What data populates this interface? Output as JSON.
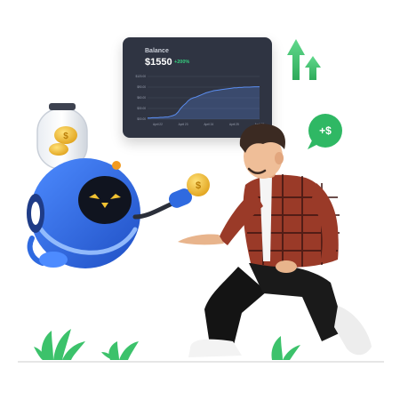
{
  "chart_data": {
    "type": "area",
    "title": "Balance",
    "balance": "$1550",
    "change": "+200%",
    "y_ticks": [
      "$120.00",
      "$90.00",
      "$60.00",
      "$30.00",
      "$00.00"
    ],
    "x_ticks": [
      "April 22",
      "April 23",
      "April 24",
      "April 25",
      "April 26"
    ],
    "ylim": [
      0,
      120
    ],
    "x": [
      0,
      0.1,
      0.2,
      0.3,
      0.4,
      0.5,
      0.6,
      0.7,
      0.8,
      0.9,
      1.0,
      1.1,
      1.2,
      1.3,
      1.4,
      1.5,
      1.6,
      1.7,
      1.8,
      1.9,
      2.0,
      2.1,
      2.2,
      2.3,
      2.4,
      2.5,
      2.6,
      2.7,
      2.8,
      2.9,
      3.0,
      3.1,
      3.2,
      3.3,
      3.4,
      3.5,
      3.6,
      3.7,
      3.8,
      3.9,
      4.0,
      4.2,
      4.4
    ],
    "values": [
      3,
      3,
      4,
      4,
      4,
      5,
      5,
      6,
      6,
      8,
      10,
      13,
      20,
      30,
      38,
      44,
      52,
      57,
      60,
      62,
      65,
      68,
      71,
      74,
      76,
      78,
      80,
      81,
      82,
      83,
      84,
      85,
      86,
      87,
      88,
      88,
      89,
      89,
      90,
      90,
      90,
      91,
      91
    ],
    "grid": true,
    "colors": {
      "line": "#5b8def",
      "fill": "#5b8def",
      "card": "#2f3442",
      "positive": "#35d07f"
    }
  },
  "badge": {
    "text": "+$",
    "color": "#2fb864"
  },
  "arrows": {
    "color": "#3cc26b"
  },
  "robot": {
    "body": "#2f6ae0",
    "face": "#10141f",
    "eyes": "#f2c232"
  },
  "coin_symbol": "$",
  "person": {
    "shirt": "#9a3a28",
    "pants": "#141414",
    "shoes": "#f3f3f3"
  }
}
